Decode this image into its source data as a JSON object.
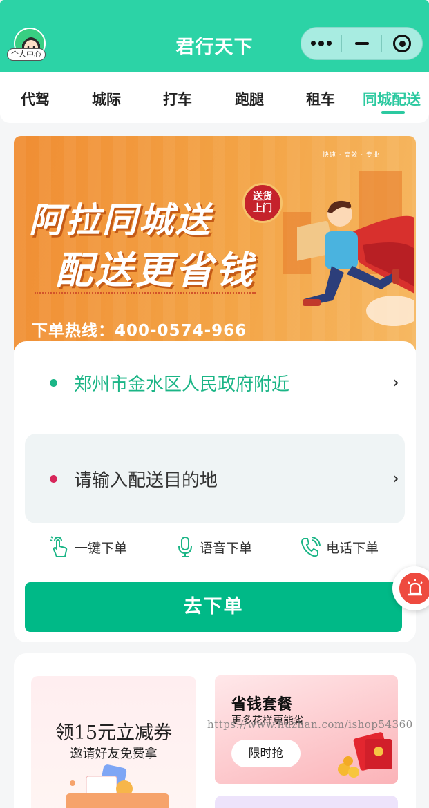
{
  "header": {
    "title": "君行天下",
    "avatar_label": "个人中心",
    "accent": "#2cd3a6"
  },
  "tabs": [
    {
      "label": "代驾"
    },
    {
      "label": "城际"
    },
    {
      "label": "打车"
    },
    {
      "label": "跑腿"
    },
    {
      "label": "租车"
    },
    {
      "label": "同城配送",
      "active": true
    }
  ],
  "banner": {
    "tagline": "快速 · 高效 · 专业",
    "headline1": "阿拉同城送",
    "headline2": "配送更省钱",
    "badge_line1": "送货",
    "badge_line2": "上门",
    "hotline": "下单热线：400-0574-966"
  },
  "order": {
    "from_address": "郑州市金水区人民政府附近",
    "to_placeholder": "请输入配送目的地",
    "quick_actions": [
      {
        "label": "一键下单",
        "icon": "tap-icon"
      },
      {
        "label": "语音下单",
        "icon": "microphone-icon"
      },
      {
        "label": "电话下单",
        "icon": "phone-icon"
      }
    ],
    "submit_label": "去下单",
    "button_color": "#00b987"
  },
  "promos": {
    "coupon_title": "领15元立减券",
    "coupon_subtitle": "邀请好友免费拿",
    "saver_title": "省钱套餐",
    "saver_subtitle": "更多花样更能省",
    "saver_button": "限时抢"
  },
  "watermark": "https://www.huzhan.com/ishop54360"
}
